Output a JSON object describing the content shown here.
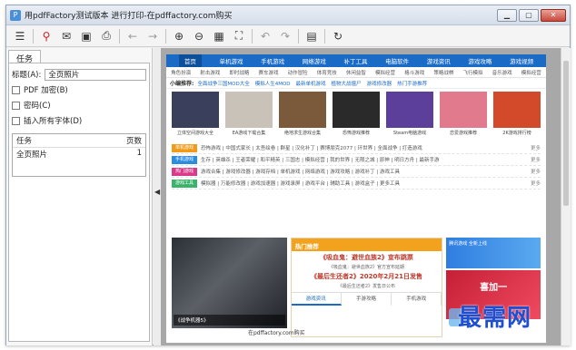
{
  "window": {
    "title": "用pdfFactory测试版本 进行打印-在pdffactory.com购买",
    "min_label": "▁",
    "max_label": "▢",
    "close_label": "✕"
  },
  "toolbar": {
    "icons": [
      "menu-icon",
      "pdf-icon",
      "email-icon",
      "save-icon",
      "print-icon",
      "back-arrow-icon",
      "forward-arrow-icon",
      "zoom-in-icon",
      "zoom-out-icon",
      "grid-icon",
      "fit-page-icon",
      "undo-icon",
      "redo-icon",
      "notes-icon",
      "refresh-icon"
    ]
  },
  "left_panel": {
    "tab_label": "任务",
    "title_label": "标题(A):",
    "title_value": "全页照片",
    "pdf_encrypt_label": "PDF 加密(B)",
    "password_label": "密码(C)",
    "embed_fonts_label": "插入所有字体(D)",
    "list_header_task": "任务",
    "list_header_pages": "页数",
    "rows": [
      {
        "task": "全页照片",
        "pages": "1"
      }
    ]
  },
  "preview": {
    "nav": [
      "首页",
      "单机游戏",
      "手机游戏",
      "网络游戏",
      "补丁工具",
      "电脑软件",
      "游戏资讯",
      "游戏攻略",
      "游戏视频"
    ],
    "subnav": [
      "角色扮演",
      "射击游戏",
      "即时战略",
      "赛车游戏",
      "动作冒险",
      "体育竞技",
      "休闲益智",
      "模拟经营",
      "格斗游戏",
      "策略战棋",
      "飞行模拟",
      "音乐游戏",
      "模拟经营"
    ],
    "rec_title": "小编推荐:",
    "rec_links": [
      "全面战争三国MOD大全",
      "模拟人生4MOD",
      "最新单机游戏",
      "植物大战僵尸",
      "游戏修改器",
      "热门手游推荐"
    ],
    "thumbs": [
      {
        "caption": "立体空间游戏大全",
        "color": "#3a3f5c"
      },
      {
        "caption": "EA游戏下载合集",
        "color": "#c9c2b8"
      },
      {
        "caption": "绝地求生游戏合集",
        "color": "#7a5a3a"
      },
      {
        "caption": "恐怖游戏推荐",
        "color": "#2a2a2a"
      },
      {
        "caption": "Steam电脑游戏",
        "color": "#5b3f9b"
      },
      {
        "caption": "恋爱游戏推荐",
        "color": "#e07a8c"
      },
      {
        "caption": "2K游戏排行榜",
        "color": "#d24a2a"
      }
    ],
    "cats": [
      {
        "tag": "单机游戏",
        "color": "#f29b1b",
        "links": "恐怖游戏 | 中国式家长 | 太吾绘卷 | 群星 | 汉化补丁 | 赛博朋克2077 | 环世界 | 全面战争 | 打造游戏"
      },
      {
        "tag": "手机游戏",
        "color": "#2a8be0",
        "links": "生存 | 英雄杀 | 王者荣耀 | 和平精英 | 三国志 | 模拟经营 | 我的世界 | 无限之城 | 原神 | 明日方舟 | 最新手游"
      },
      {
        "tag": "热门游戏",
        "color": "#d93a8a",
        "links": "游戏合集 | 游戏修改器 | 游戏存档 | 单机游戏 | 网络游戏 | 游戏攻略 | 游戏补丁 | 游戏工具"
      },
      {
        "tag": "游戏工具",
        "color": "#3cb36a",
        "links": "模拟器 | 万能修改器 | 游戏加速器 | 游戏录屏 | 游戏平台 | 辅助工具 | 游戏盒子 | 更多工具"
      }
    ],
    "poster_caption": "《战争机器5》",
    "hot_title": "热门推荐",
    "hot_items": [
      "《吸血鬼：避世血族2》宣布跳票",
      "《最后生还者2》2020年2月21日发售"
    ],
    "hot_subs": [
      "《吸血鬼：避世血族2》官方宣布延期",
      "《最后生还者2》发售日公布"
    ],
    "hot_tabs": [
      "游戏资讯",
      "手游攻略",
      "手机游戏"
    ],
    "ad_top": "腾讯游戏 全新上线",
    "ad_bottom": "喜加一",
    "footer_url": "在pdffactory.com购买"
  },
  "watermark": "最需网"
}
